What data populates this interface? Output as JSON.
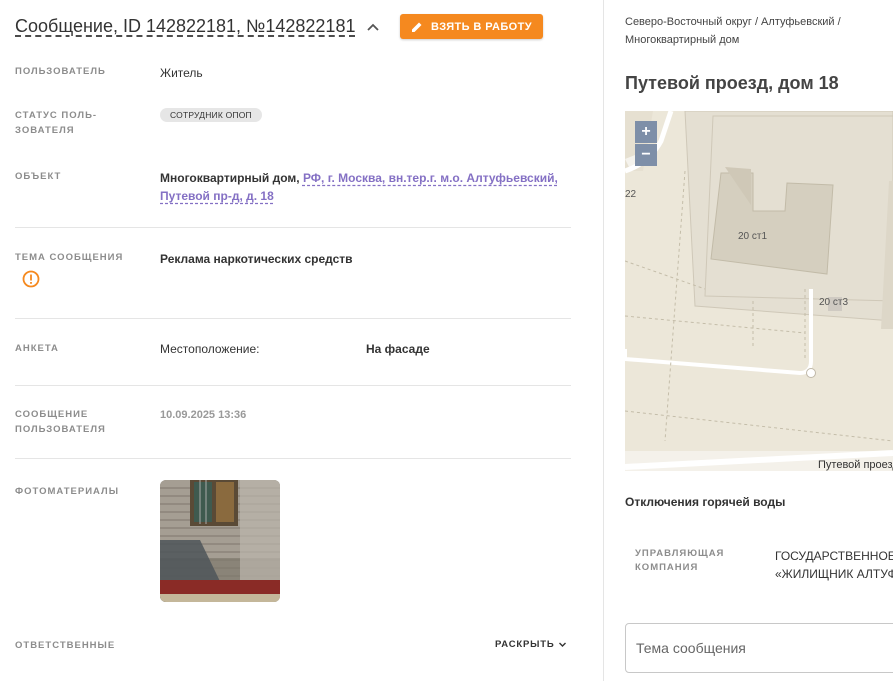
{
  "header": {
    "title": "Сообщение, ID 142822181, №142822181",
    "take_button": "ВЗЯТЬ В РАБОТУ"
  },
  "fields": {
    "user": {
      "label": "ПОЛЬЗОВАТЕЛЬ",
      "value": "Житель"
    },
    "user_status": {
      "label": "СТАТУС ПОЛЬ-\nЗОВАТЕЛЯ",
      "value": "СОТРУДНИК ОПОП"
    },
    "object": {
      "label": "ОБЪЕКТ",
      "type": "Многоквартирный дом,",
      "address_link": "РФ, г. Москва, вн.тер.г. м.о. Алтуфьевский, Путевой пр-д, д. 18"
    },
    "topic": {
      "label": "ТЕМА СООБЩЕНИЯ",
      "value": "Реклама наркотических средств",
      "icon": "warning-circle-icon"
    },
    "form": {
      "label": "АНКЕТА",
      "question": "Местоположение:",
      "answer": "На фасаде"
    },
    "user_message": {
      "label": "СООБЩЕНИЕ ПОЛЬЗОВАТЕЛЯ",
      "value": "10.09.2025 13:36"
    },
    "photos": {
      "label": "ФОТОМАТЕРИАЛЫ"
    },
    "responsible": {
      "label": "ОТВЕТСТВЕННЫЕ",
      "expand": "РАСКРЫТЬ"
    }
  },
  "sidebar": {
    "breadcrumbs": "Северо-Восточный округ / Алтуфьевский / Многоквартирный дом",
    "address": "Путевой проезд, дом 18",
    "map": {
      "zoom_in": "+",
      "zoom_out": "−",
      "labels": {
        "building_main": "20 ст1",
        "building_small": "20 ст3",
        "left_number": "22",
        "street": "Путевой проезд"
      }
    },
    "section_title": "Отключения горячей воды",
    "management": {
      "label": "УПРАВЛЯЮЩАЯ КОМПАНИЯ",
      "value_line1": "ГОСУДАРСТВЕННОЕ",
      "value_line2": "«ЖИЛИЩНИК АЛТУФ"
    },
    "topic_placeholder": "Тема сообщения"
  },
  "colors": {
    "accent": "#f5891f",
    "link": "#8470c4",
    "map_bg": "#ece7d9",
    "zoom": "#7e8fa8"
  }
}
